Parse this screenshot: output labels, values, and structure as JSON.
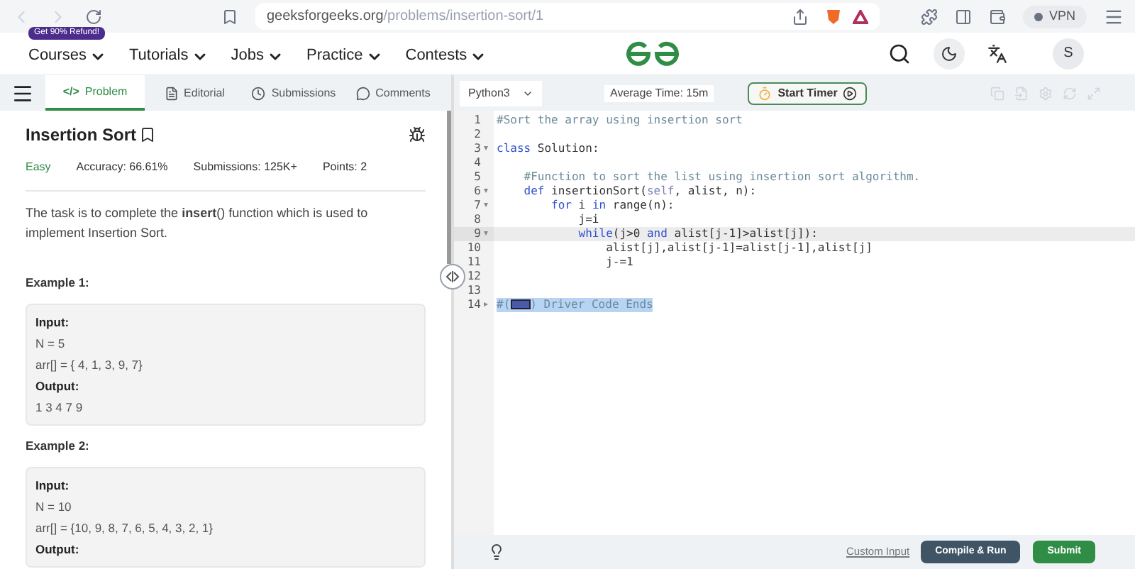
{
  "browser": {
    "url_host": "geeksforgeeks.org",
    "url_path": "/problems/insertion-sort/1",
    "vpn": "VPN"
  },
  "site_nav": {
    "badge": "Get 90% Refund!",
    "items": [
      "Courses",
      "Tutorials",
      "Jobs",
      "Practice",
      "Contests"
    ],
    "avatar": "S"
  },
  "tabs": [
    {
      "glyph": "</>",
      "label": "Problem",
      "selected": true
    },
    {
      "label": "Editorial",
      "selected": false
    },
    {
      "label": "Submissions",
      "selected": false
    },
    {
      "label": "Comments",
      "selected": false
    }
  ],
  "problem": {
    "title": "Insertion Sort",
    "difficulty": "Easy",
    "accuracy": "Accuracy: 66.61%",
    "submissions": "Submissions: 125K+",
    "points": "Points: 2",
    "description": "The task is to complete the **insert**() function which is used to implement Insertion Sort.",
    "examples": [
      {
        "title": "Example 1:",
        "lines": [
          {
            "kind": "label",
            "text": "Input:"
          },
          {
            "kind": "value",
            "text": "N = 5"
          },
          {
            "kind": "value",
            "text": "arr[] = { 4, 1, 3, 9, 7}"
          },
          {
            "kind": "label",
            "text": "Output:"
          },
          {
            "kind": "value",
            "text": "1 3 4 7 9"
          }
        ]
      },
      {
        "title": "Example 2:",
        "lines": [
          {
            "kind": "label",
            "text": "Input:"
          },
          {
            "kind": "value",
            "text": "N = 10"
          },
          {
            "kind": "value",
            "text": "arr[] = {10, 9, 8, 7, 6, 5, 4, 3, 2, 1}"
          },
          {
            "kind": "label",
            "text": "Output:"
          }
        ]
      }
    ]
  },
  "editor": {
    "language": "Python3",
    "average_time": "Average Time: 15m",
    "timer_button": "Start Timer",
    "lines": [
      {
        "number": "1",
        "active": false,
        "selected": false,
        "segments": [
          {
            "kind": "comment",
            "text": "#Sort the array using insertion sort"
          }
        ]
      },
      {
        "number": "2",
        "active": false,
        "selected": false
      },
      {
        "number": "3",
        "fold_glyph": "▾",
        "active": false,
        "selected": false,
        "segments": [
          {
            "kind": "keyword",
            "text": "class"
          },
          {
            "kind": "plain",
            "text": " Solution:"
          }
        ]
      },
      {
        "number": "4",
        "active": false,
        "selected": false
      },
      {
        "number": "5",
        "active": false,
        "selected": false,
        "segments": [
          {
            "kind": "comment",
            "text": "    #Function to sort the list using insertion sort algorithm."
          }
        ]
      },
      {
        "number": "6",
        "fold_glyph": "▾",
        "active": false,
        "selected": false,
        "segments": [
          {
            "kind": "keyword",
            "text": "    def"
          },
          {
            "kind": "plain",
            "text": " insertionSort("
          },
          {
            "kind": "builtin",
            "text": "self"
          },
          {
            "kind": "plain",
            "text": ", alist, n):"
          }
        ]
      },
      {
        "number": "7",
        "fold_glyph": "▾",
        "active": false,
        "selected": false,
        "segments": [
          {
            "kind": "keyword",
            "text": "        for"
          },
          {
            "kind": "plain",
            "text": " i "
          },
          {
            "kind": "keyword",
            "text": "in"
          },
          {
            "kind": "plain",
            "text": " range(n):"
          }
        ]
      },
      {
        "number": "8",
        "active": false,
        "selected": false,
        "segments": [
          {
            "kind": "plain",
            "text": "            j=i"
          }
        ]
      },
      {
        "number": "9",
        "fold_glyph": "▾",
        "active": true,
        "selected": false,
        "segments": [
          {
            "kind": "keyword",
            "text": "            while"
          },
          {
            "kind": "plain",
            "text": "(j>0 "
          },
          {
            "kind": "keyword",
            "text": "and"
          },
          {
            "kind": "plain",
            "text": " alist[j-1]>alist[j]):"
          }
        ]
      },
      {
        "number": "10",
        "active": false,
        "selected": false,
        "segments": [
          {
            "kind": "plain",
            "text": "                alist[j],alist[j-1]=alist[j-1],alist[j]"
          }
        ]
      },
      {
        "number": "11",
        "active": false,
        "selected": false,
        "segments": [
          {
            "kind": "plain",
            "text": "                j-=1"
          }
        ]
      },
      {
        "number": "12",
        "active": false,
        "selected": false
      },
      {
        "number": "13",
        "active": false,
        "selected": false
      },
      {
        "number": "14",
        "fold_glyph": "▸",
        "active": false,
        "selected": true,
        "segments": [
          {
            "kind": "comment",
            "text": "#("
          },
          {
            "kind": "foldmark"
          },
          {
            "kind": "comment",
            "text": ") Driver Code Ends"
          }
        ]
      }
    ],
    "custom_input": "Custom Input",
    "run_button": "Compile & Run",
    "submit_button": "Submit"
  }
}
